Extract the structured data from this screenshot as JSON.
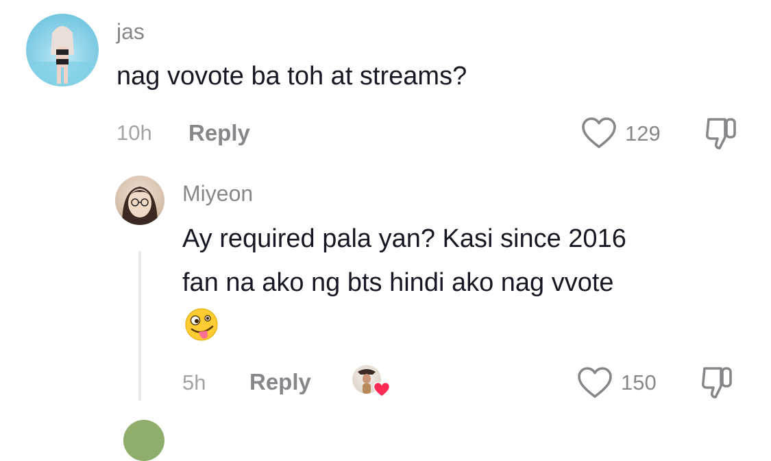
{
  "comment": {
    "username": "jas",
    "text": "nag vovote ba toh at streams?",
    "time": "10h",
    "reply_label": "Reply",
    "like_count": "129"
  },
  "reply": {
    "username": "Miyeon",
    "text_line1": "Ay required pala yan? Kasi since 2016",
    "text_line2": "fan na ako ng bts hindi ako nag vvote",
    "emoji": "🤪",
    "time": "5h",
    "reply_label": "Reply",
    "like_count": "150"
  },
  "colors": {
    "heart_badge": "#fe2c55",
    "secondary_text": "#86878b",
    "primary_text": "#161823"
  },
  "icons": {
    "like": "heart-outline-icon",
    "dislike": "thumbs-down-icon",
    "creator_liked": "heart-filled-icon"
  }
}
